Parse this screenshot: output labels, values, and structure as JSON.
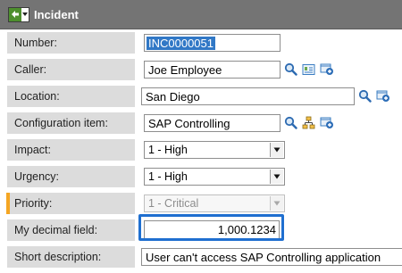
{
  "header": {
    "title": "Incident",
    "back_icon": "back-arrow-icon",
    "menu_icon": "context-menu-icon"
  },
  "fields": {
    "number": {
      "label": "Number:",
      "value": "INC0000051"
    },
    "caller": {
      "label": "Caller:",
      "value": "Joe Employee"
    },
    "location": {
      "label": "Location:",
      "value": "San Diego"
    },
    "config_item": {
      "label": "Configuration item:",
      "value": "SAP Controlling"
    },
    "impact": {
      "label": "Impact:",
      "value": "1 - High"
    },
    "urgency": {
      "label": "Urgency:",
      "value": "1 - High"
    },
    "priority": {
      "label": "Priority:",
      "value": "1 - Critical"
    },
    "decimal": {
      "label": "My decimal field:",
      "value": "1,000.1234"
    },
    "short_desc": {
      "label": "Short description:",
      "value": "User can't access SAP Controlling application"
    }
  },
  "colors": {
    "header_bg": "#747474",
    "label_bg": "#dcdcdc",
    "highlight": "#1f6fd0",
    "priority_marker": "#f5a623"
  }
}
